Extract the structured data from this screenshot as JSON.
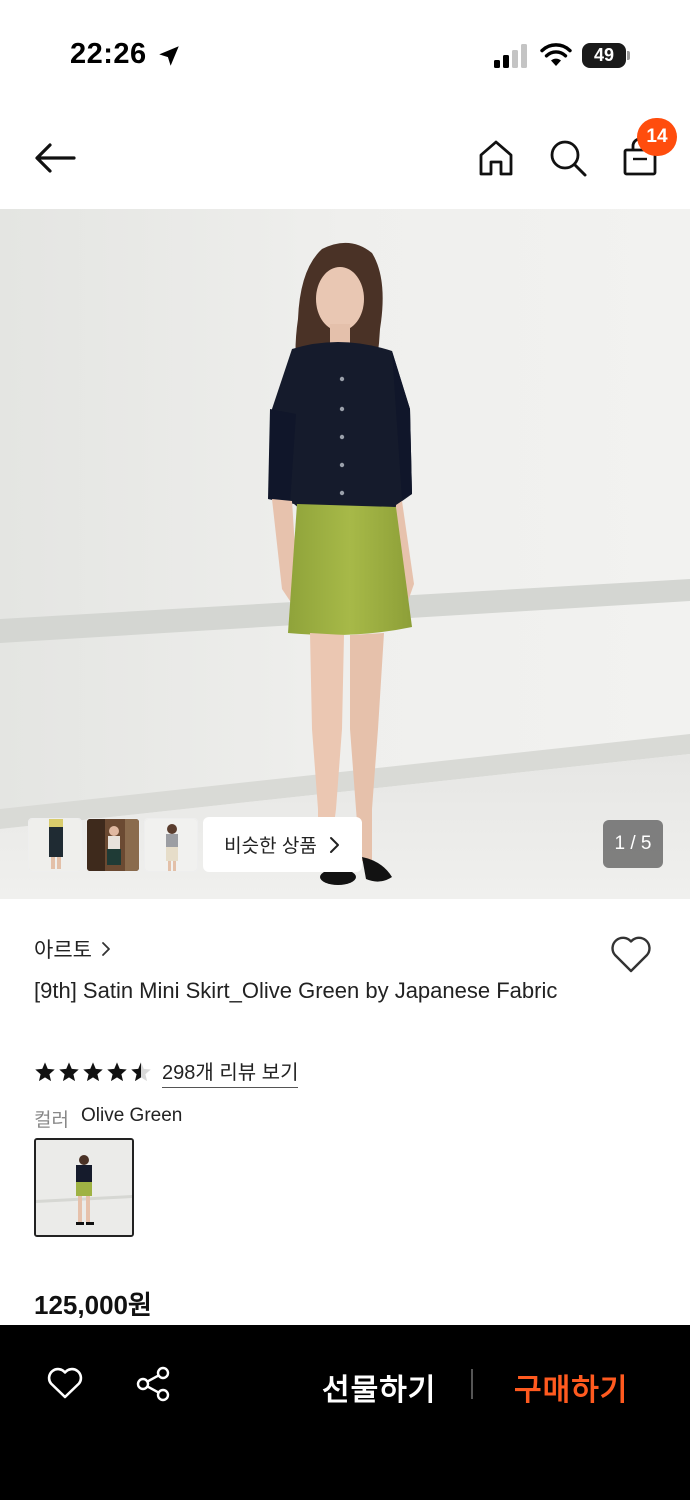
{
  "status_bar": {
    "time": "22:26",
    "battery": "49",
    "icons": [
      "location-arrow-icon",
      "signal-icon",
      "wifi-icon",
      "battery-icon"
    ]
  },
  "nav": {
    "icons": [
      "back-arrow-icon",
      "home-icon",
      "search-icon",
      "shopping-bag-icon"
    ],
    "cart_count": "14"
  },
  "gallery": {
    "similar_label": "비슷한 상품",
    "page_indicator": "1 / 5",
    "thumbnail_count": 3
  },
  "product": {
    "brand": "아르토",
    "title": "[9th] Satin Mini Skirt_Olive Green by Japanese Fabric",
    "rating": 4.5,
    "review_link": "298개 리뷰 보기",
    "color_label": "컬러",
    "color_value": "Olive Green",
    "price": "125,000원"
  },
  "bottom_bar": {
    "gift_label": "선물하기",
    "buy_label": "구매하기"
  },
  "colors": {
    "accent": "#ff4d0d",
    "buy_text": "#ff5a1f",
    "bottom_bar_bg": "#000000"
  }
}
